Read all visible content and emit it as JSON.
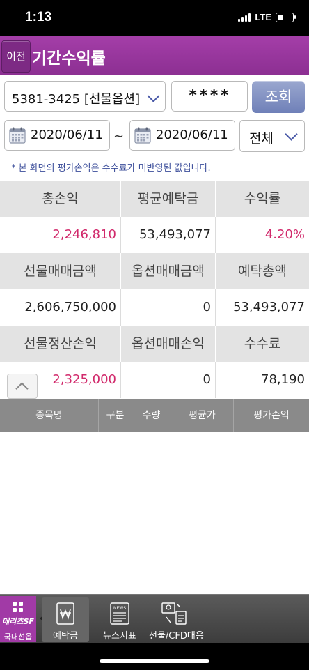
{
  "status_bar": {
    "time": "1:13",
    "network": "LTE"
  },
  "header": {
    "back_label": "이전",
    "title": "기간수익률"
  },
  "account": {
    "selected": "5381-3425 [선물옵션]",
    "password_mask": "****",
    "query_label": "조회"
  },
  "period": {
    "start_date": "2020/06/11",
    "separator": "~",
    "end_date": "2020/06/11",
    "type_selected": "전체"
  },
  "notice": "* 본 화면의 평가손익은 수수료가 미반영된 값입니다.",
  "summary": {
    "row1": {
      "headers": [
        "총손익",
        "평균예탁금",
        "수익률"
      ],
      "values": [
        "2,246,810",
        "53,493,077",
        "4.20%"
      ]
    },
    "row2": {
      "headers": [
        "선물매매금액",
        "옵션매매금액",
        "예탁총액"
      ],
      "values": [
        "2,606,750,000",
        "0",
        "53,493,077"
      ]
    },
    "row3": {
      "headers": [
        "선물정산손익",
        "옵션매매손익",
        "수수료"
      ],
      "values": [
        "2,325,000",
        "0",
        "78,190"
      ]
    }
  },
  "list": {
    "columns": [
      "종목명",
      "구분",
      "수량",
      "평균가",
      "평가손익"
    ],
    "rows": []
  },
  "tabbar": {
    "menu_brand": "메리츠SF",
    "menu_sub": "국내선옵",
    "tabs": [
      {
        "label": "예탁금",
        "icon": "won-icon"
      },
      {
        "label": "뉴스지표",
        "icon": "news-icon"
      },
      {
        "label": "선물/CFD대응",
        "icon": "futures-cfd-icon"
      }
    ]
  },
  "colors": {
    "header_purple": "#9a3aa0",
    "accent_pink": "#d1296b",
    "query_button": "#7f8ec2"
  }
}
